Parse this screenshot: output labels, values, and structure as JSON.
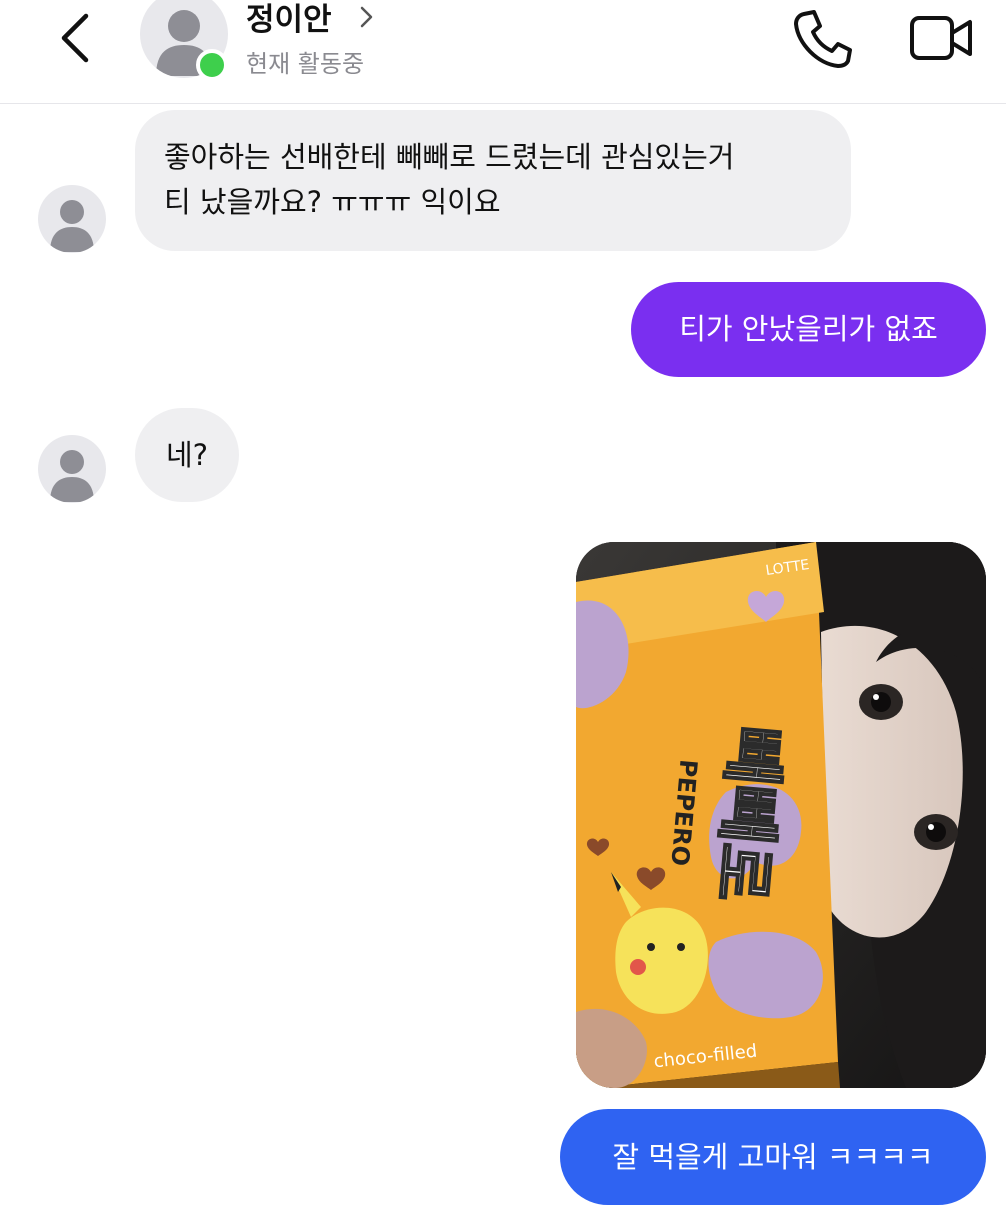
{
  "header": {
    "contact_name": "정이안",
    "status": "현재 활동중",
    "icons": {
      "back": "chevron-left-icon",
      "profile": "chevron-right-icon",
      "call": "phone-icon",
      "video": "video-camera-icon"
    },
    "online_color": "#3ecf4c"
  },
  "messages": [
    {
      "from": "them",
      "lines": [
        "좋아하는 선배한테 빼빼로 드렸는데 관심있는거",
        "티 났을까요? ㅠㅠㅠ 익이요"
      ]
    },
    {
      "from": "me",
      "text": "티가 안났을리가 없죠",
      "color": "#7a2ff0"
    },
    {
      "from": "them",
      "text": "네?"
    },
    {
      "from": "me",
      "type": "photo",
      "box": {
        "brand": "LOTTE",
        "title": "빼빼로",
        "subtitle": "PEPERO",
        "flavor": "choco-filled"
      }
    },
    {
      "from": "me",
      "text": "잘 먹을게 고마워 ㅋㅋㅋㅋ",
      "color": "#2f63f2"
    }
  ]
}
